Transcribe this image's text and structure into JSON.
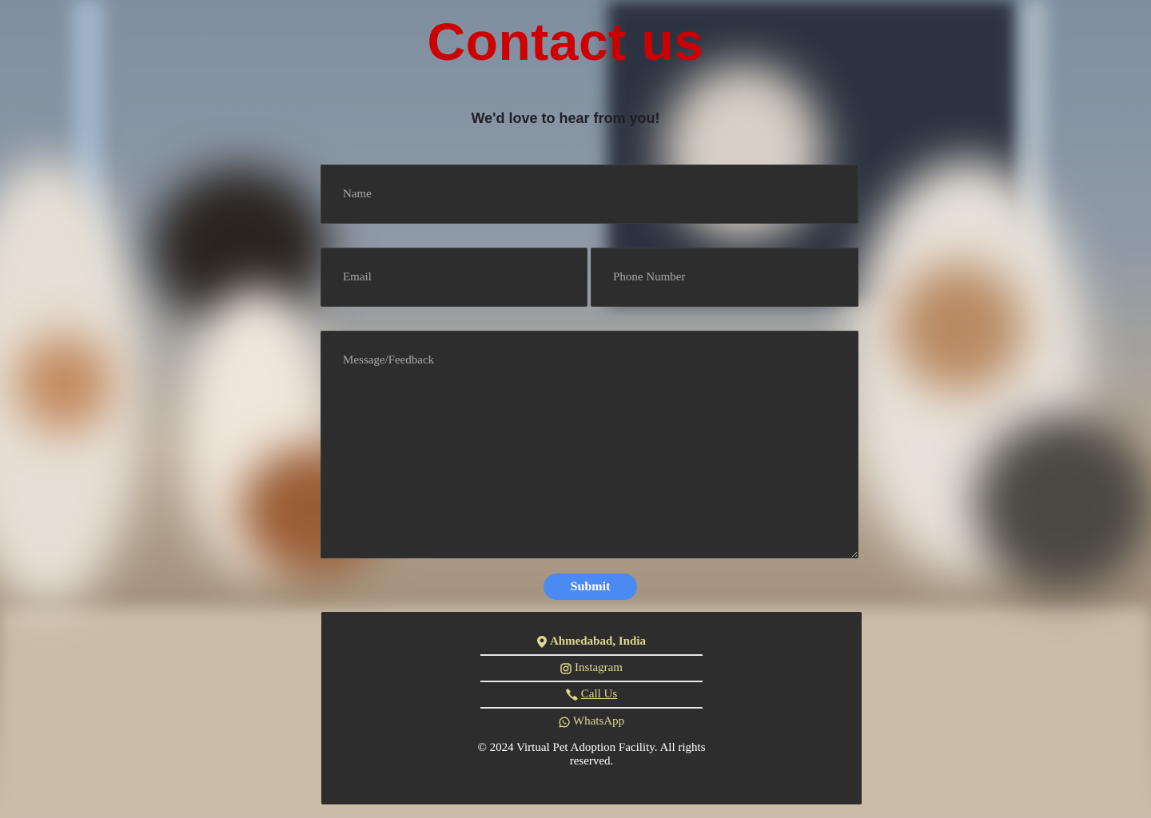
{
  "header": {
    "title": "Contact us",
    "subtitle": "We'd love to hear from you!"
  },
  "form": {
    "name_placeholder": "Name",
    "email_placeholder": "Email",
    "phone_placeholder": "Phone Number",
    "message_placeholder": "Message/Feedback",
    "submit_label": "Submit"
  },
  "footer": {
    "location": {
      "icon": "map-pin-icon",
      "label": "Ahmedabad, India"
    },
    "instagram": {
      "icon": "instagram-icon",
      "label": "Instagram"
    },
    "call": {
      "icon": "phone-icon",
      "label": "Call Us"
    },
    "whatsapp": {
      "icon": "whatsapp-icon",
      "label": "WhatsApp"
    },
    "copyright": "© 2024 Virtual Pet Adoption Facility. All rights reserved."
  },
  "colors": {
    "title": "#cc0000",
    "submit_button": "#4a8af2",
    "panel": "#2d2d2d",
    "footer_link": "#e0d98c"
  }
}
